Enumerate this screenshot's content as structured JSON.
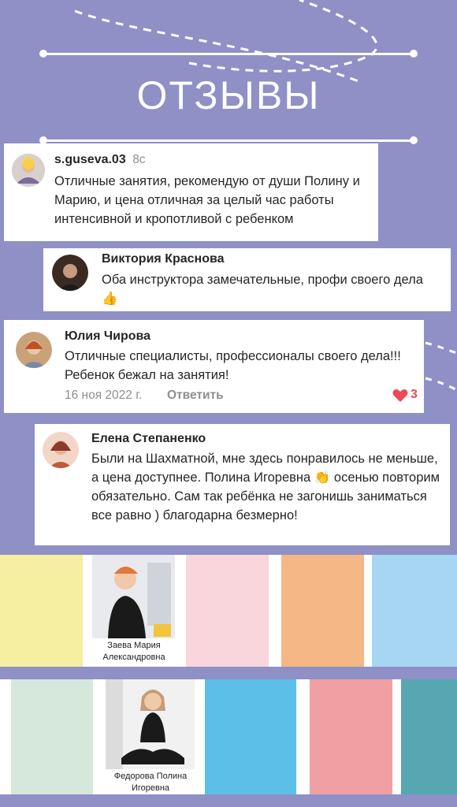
{
  "heading": "ОТЗЫВЫ",
  "reviews": [
    {
      "user": "s.guseva.03",
      "time": "8c",
      "text": "Отличные занятия, рекомендую от души Полину и Марию, и цена отличная за целый час работы интенсивной и кропотливой с ребенком"
    },
    {
      "user": "Виктория Краснова",
      "text": "Оба инструктора замечательные, профи своего дела 👍"
    },
    {
      "user": "Юлия Чирова",
      "text": "Отличные специалисты, профессионалы своего дела!!! Ребенок бежал на занятия!",
      "date": "16 ноя 2022 г.",
      "reply": "Ответить",
      "likes": "3"
    },
    {
      "user": "Елена Степаненко",
      "text": "Были на Шахматной, мне здесь понравилось не меньше, а цена доступнее. Полина Игоревна 👏 осенью повторим обязательно. Сам так ребёнка не загонишь заниматься все равно ) благодарна безмерно!"
    }
  ],
  "instructors": [
    {
      "caption_line1": "Заева Мария",
      "caption_line2": "Александровна"
    },
    {
      "caption_line1": "Федорова Полина",
      "caption_line2": "Игоревна"
    }
  ],
  "colors": {
    "background": "#8e90c6",
    "row1": [
      "#f6eea0",
      "#f8d6dc",
      "#f4b785",
      "#a6d6f2"
    ],
    "row2": [
      "#d6e8dc",
      "#5bbfe7",
      "#f09fa2",
      "#56a7b2"
    ],
    "like": "#ed4956"
  }
}
